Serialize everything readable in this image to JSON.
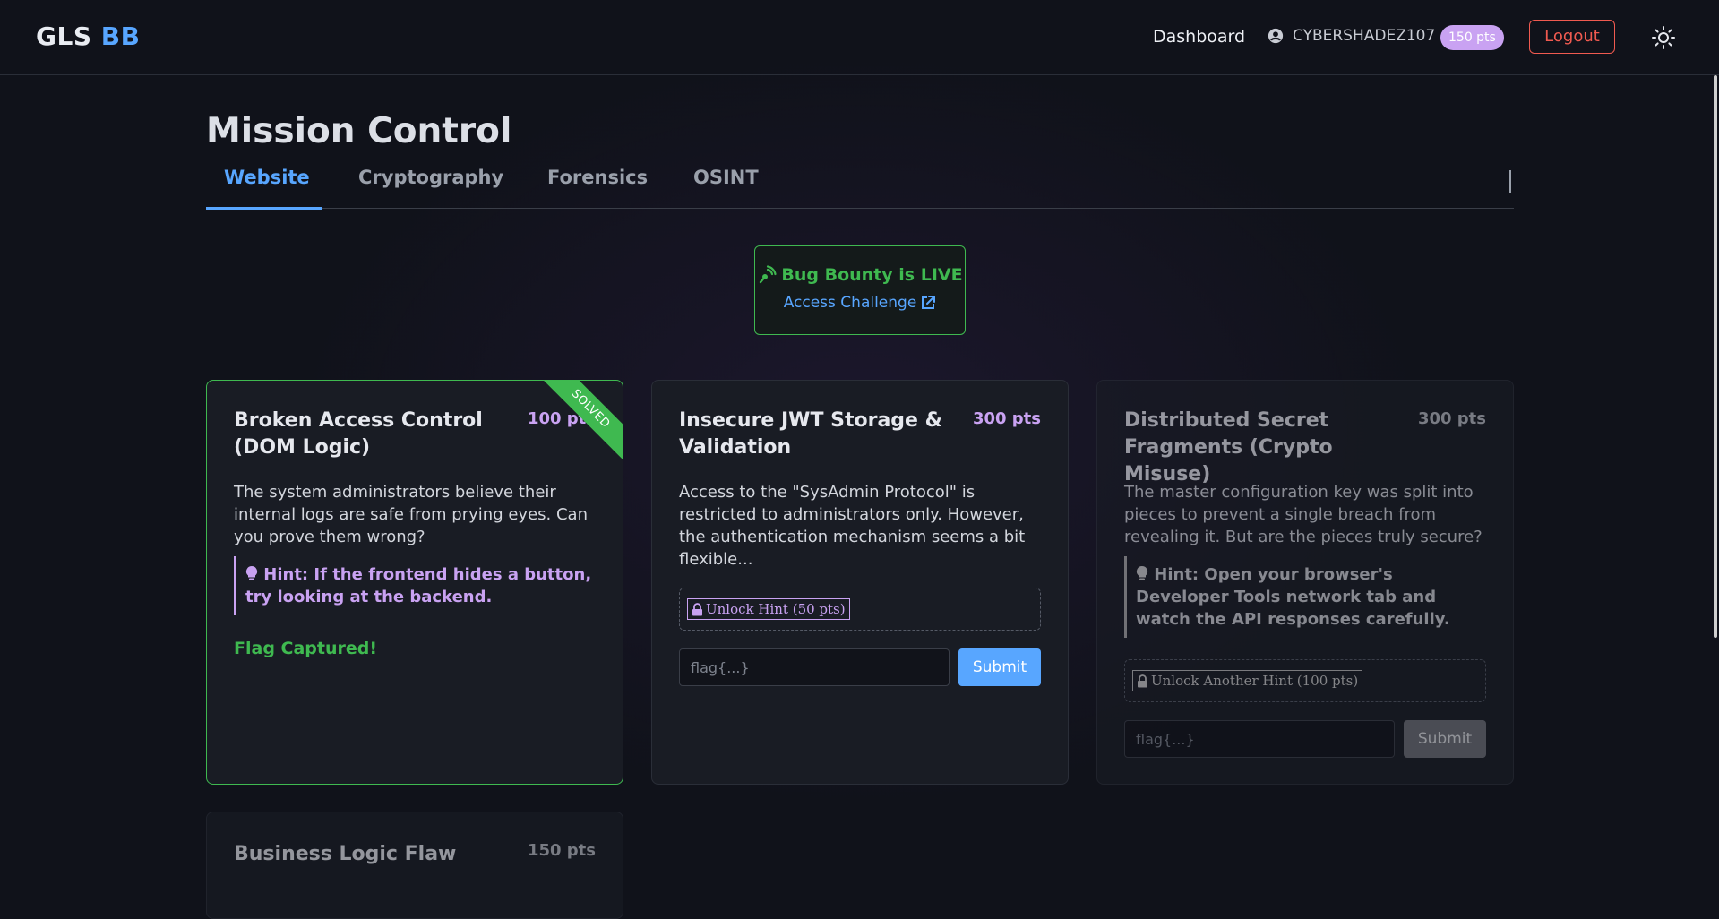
{
  "header": {
    "logo_main": "GLS",
    "logo_accent": "BB",
    "nav_dashboard": "Dashboard",
    "username": "CYBERSHADEZ107",
    "points_badge": "150 pts",
    "logout_label": "Logout"
  },
  "page_title": "Mission Control",
  "tabs": [
    {
      "label": "Website",
      "active": true
    },
    {
      "label": "Cryptography",
      "active": false
    },
    {
      "label": "Forensics",
      "active": false
    },
    {
      "label": "OSINT",
      "active": false
    }
  ],
  "bounty": {
    "title": "Bug Bounty is LIVE",
    "link": "Access Challenge"
  },
  "cards": [
    {
      "title": "Broken Access Control (DOM Logic)",
      "points": "100 pts",
      "ribbon": "SOLVED",
      "description": "The system administrators believe their internal logs are safe from prying eyes. Can you prove them wrong?",
      "hint": "Hint: If the frontend hides a button, try looking at the backend.",
      "status": "Flag Captured!"
    },
    {
      "title": "Insecure JWT Storage & Validation",
      "points": "300 pts",
      "description": "Access to the \"SysAdmin Protocol\" is restricted to administrators only. However, the authentication mechanism seems a bit flexible...",
      "unlock_label": "Unlock Hint (50 pts)",
      "flag_placeholder": "flag{...}",
      "submit_label": "Submit"
    },
    {
      "title": "Distributed Secret Fragments (Crypto Misuse)",
      "points": "300 pts",
      "description": "The master configuration key was split into pieces to prevent a single breach from revealing it. But are the pieces truly secure?",
      "hint": "Hint: Open your browser's Developer Tools network tab and watch the API responses carefully.",
      "unlock_label": "Unlock Another Hint (100 pts)",
      "flag_placeholder": "flag{...}",
      "submit_label": "Submit"
    },
    {
      "title": "Business Logic Flaw",
      "points": "150 pts"
    }
  ],
  "colors": {
    "accent_blue": "#58a6ff",
    "success_green": "#3fb950",
    "points_purple": "#c9a2f2",
    "danger_red": "#f05a50"
  }
}
